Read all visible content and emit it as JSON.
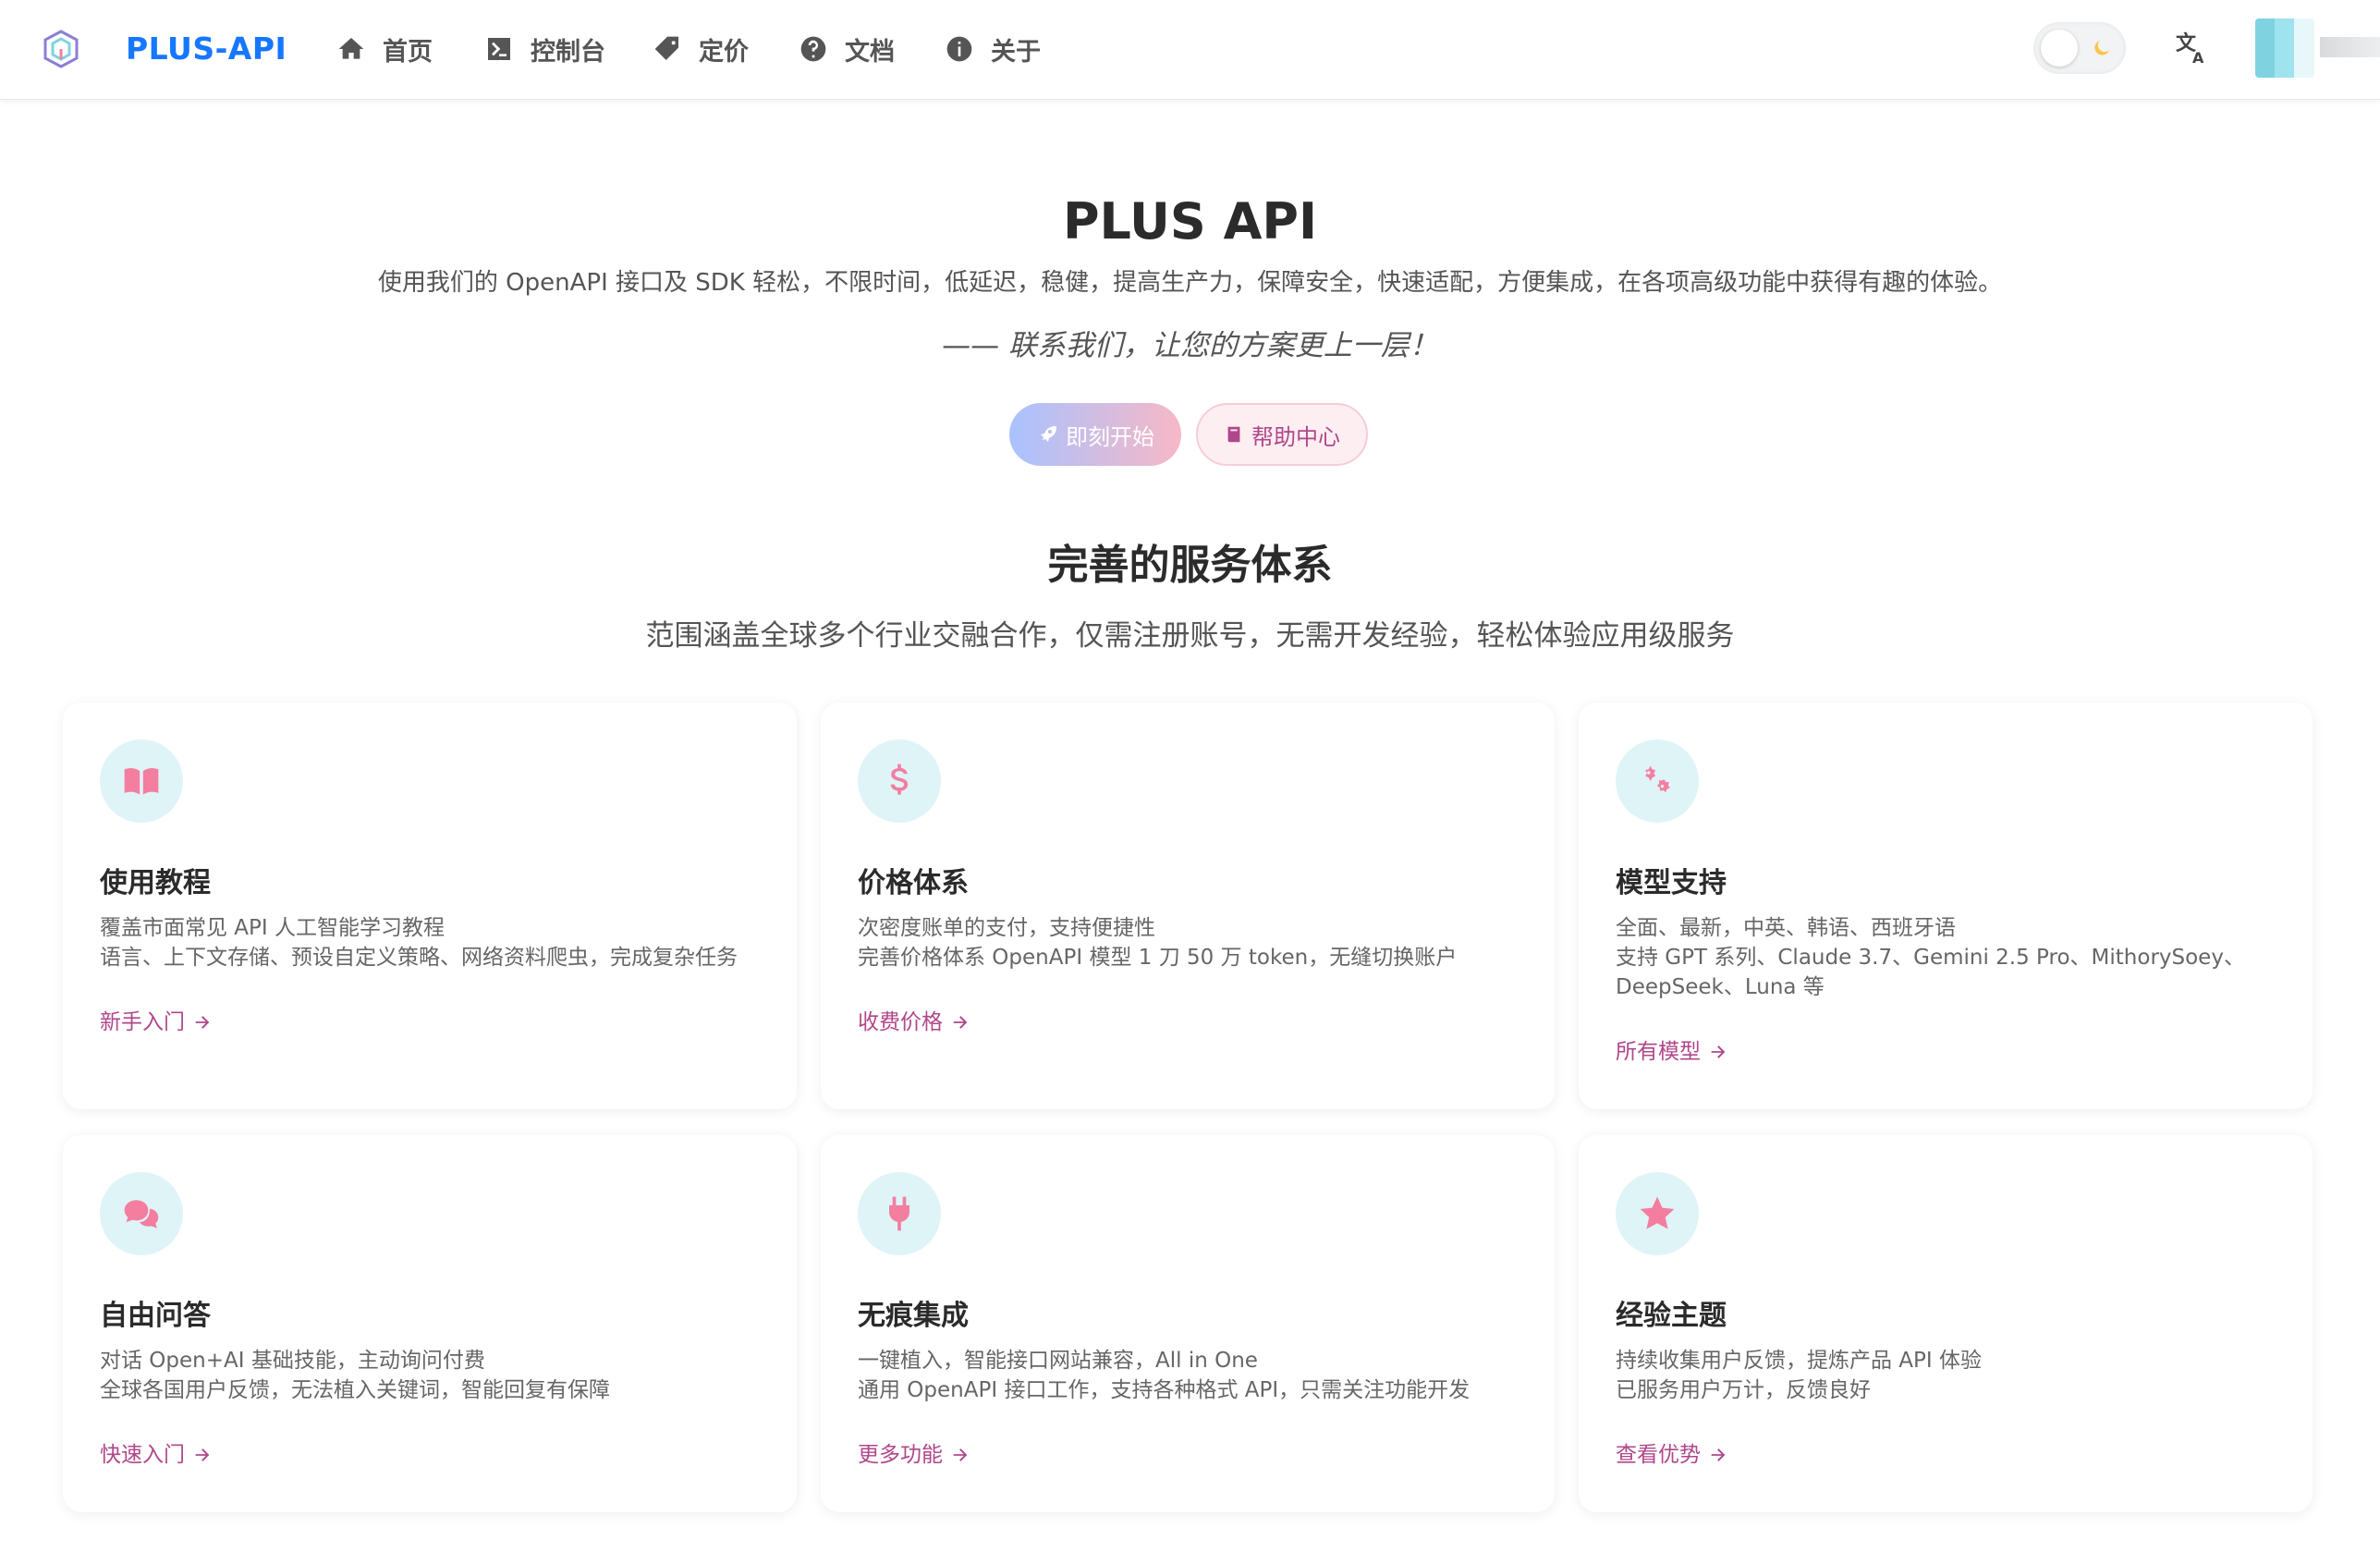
{
  "nav": {
    "brand": "PLUS-API",
    "items": [
      {
        "label": "首页",
        "icon": "home-icon"
      },
      {
        "label": "控制台",
        "icon": "terminal-icon"
      },
      {
        "label": "定价",
        "icon": "tag-icon"
      },
      {
        "label": "文档",
        "icon": "question-circle-icon"
      },
      {
        "label": "关于",
        "icon": "info-circle-icon"
      }
    ]
  },
  "hero": {
    "title": "PLUS API",
    "description": "使用我们的 OpenAPI 接口及 SDK 轻松，不限时间，低延迟，稳健，提高生产力，保障安全，快速适配，方便集成，在各项高级功能中获得有趣的体验。",
    "quote": "—— 联系我们，让您的方案更上一层！",
    "start_button": "即刻开始",
    "help_button": "帮助中心"
  },
  "section": {
    "title": "完善的服务体系",
    "subtitle": "范围涵盖全球多个行业交融合作，仅需注册账号，无需开发经验，轻松体验应用级服务"
  },
  "cards": [
    {
      "title": "使用教程",
      "lines": [
        "覆盖市面常见 API 人工智能学习教程",
        "语言、上下文存储、预设自定义策略、网络资料爬虫，完成复杂任务"
      ],
      "link": "新手入门",
      "icon": "book-icon"
    },
    {
      "title": "价格体系",
      "lines": [
        "次密度账单的支付，支持便捷性",
        "完善价格体系 OpenAPI 模型 1 刀 50 万 token，无缝切换账户"
      ],
      "link": "收费价格",
      "icon": "dollar-icon"
    },
    {
      "title": "模型支持",
      "lines": [
        "全面、最新，中英、韩语、西班牙语",
        "支持 GPT 系列、Claude 3.7、Gemini 2.5 Pro、MithorySoey、",
        "DeepSeek、Luna 等"
      ],
      "link": "所有模型",
      "icon": "gears-icon"
    },
    {
      "title": "自由问答",
      "lines": [
        "对话 Open+AI 基础技能，主动询问付费",
        "全球各国用户反馈，无法植入关键词，智能回复有保障"
      ],
      "link": "快速入门",
      "icon": "chat-bubbles-icon"
    },
    {
      "title": "无痕集成",
      "lines": [
        "一键植入，智能接口网站兼容，All in One",
        "通用 OpenAPI 接口工作，支持各种格式 API，只需关注功能开发"
      ],
      "link": "更多功能",
      "icon": "plug-icon"
    },
    {
      "title": "经验主题",
      "lines": [
        "持续收集用户反馈，提炼产品 API 体验",
        "已服务用户万计，反馈良好"
      ],
      "link": "查看优势",
      "icon": "star-icon"
    }
  ],
  "colors": {
    "brand": "#1677ff",
    "accent_pink": "#f47ea0",
    "link": "#b0478a",
    "icon_bg": "#dff4f7"
  }
}
